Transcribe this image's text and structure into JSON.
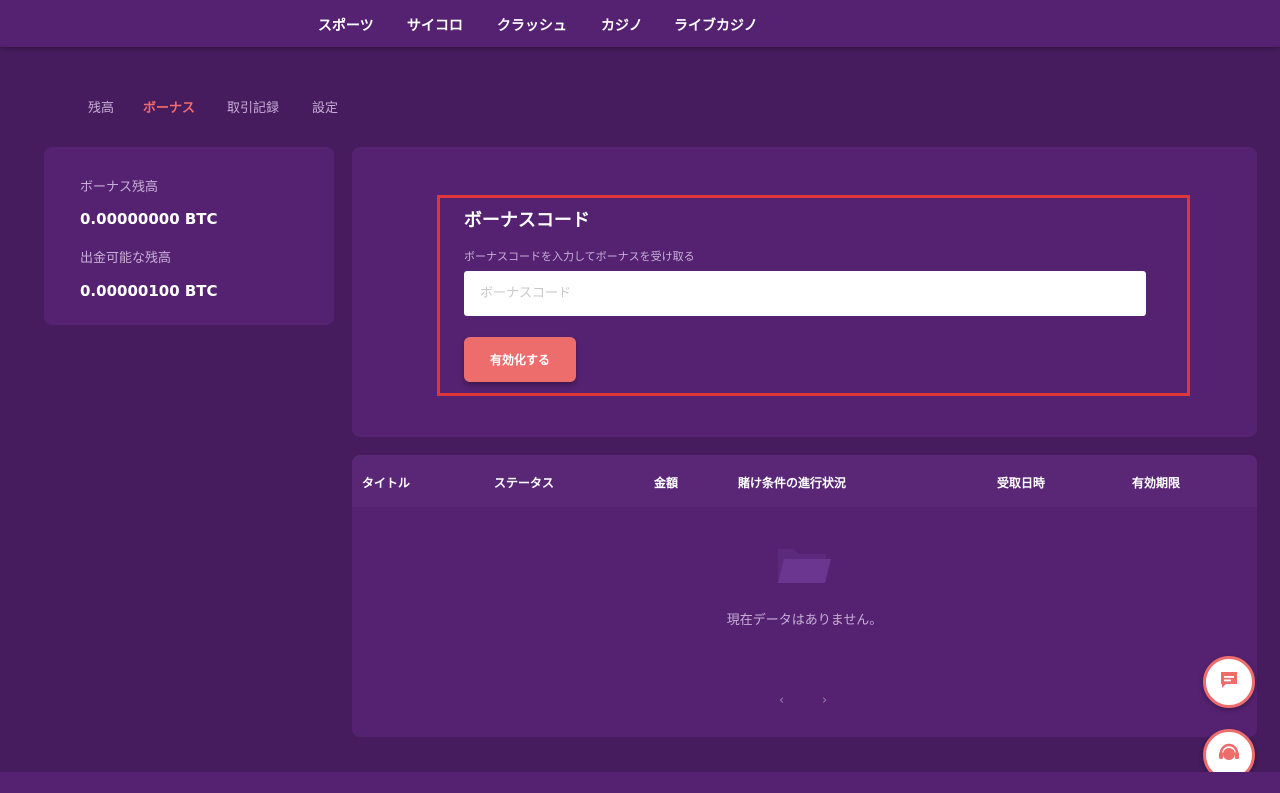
{
  "nav": {
    "items": [
      {
        "label": "スポーツ"
      },
      {
        "label": "サイコロ"
      },
      {
        "label": "クラッシュ"
      },
      {
        "label": "カジノ"
      },
      {
        "label": "ライブカジノ"
      }
    ]
  },
  "tabs": [
    {
      "label": "残高",
      "active": false
    },
    {
      "label": "ボーナス",
      "active": true
    },
    {
      "label": "取引記録",
      "active": false
    },
    {
      "label": "設定",
      "active": false
    }
  ],
  "balance": {
    "bonus_label": "ボーナス残高",
    "bonus_value": "0.00000000 BTC",
    "withdrawable_label": "出金可能な残高",
    "withdrawable_value": "0.00000100 BTC"
  },
  "bonus_code": {
    "title": "ボーナスコード",
    "description": "ボーナスコードを入力してボーナスを受け取る",
    "placeholder": "ボーナスコード",
    "value": "",
    "button_label": "有効化する"
  },
  "table": {
    "columns": [
      "タイトル",
      "ステータス",
      "金額",
      "賭け条件の進行状況",
      "受取日時",
      "有効期限"
    ],
    "rows": [],
    "empty_text": "現在データはありません。",
    "pager": {
      "prev": "‹",
      "next": "›"
    }
  },
  "icons": {
    "folder": "folder-icon",
    "chat": "chat-icon",
    "support": "support-icon"
  },
  "colors": {
    "background": "#461c5e",
    "card": "#552271",
    "accent": "#ed6d6d",
    "highlight_border": "#e0363a"
  }
}
